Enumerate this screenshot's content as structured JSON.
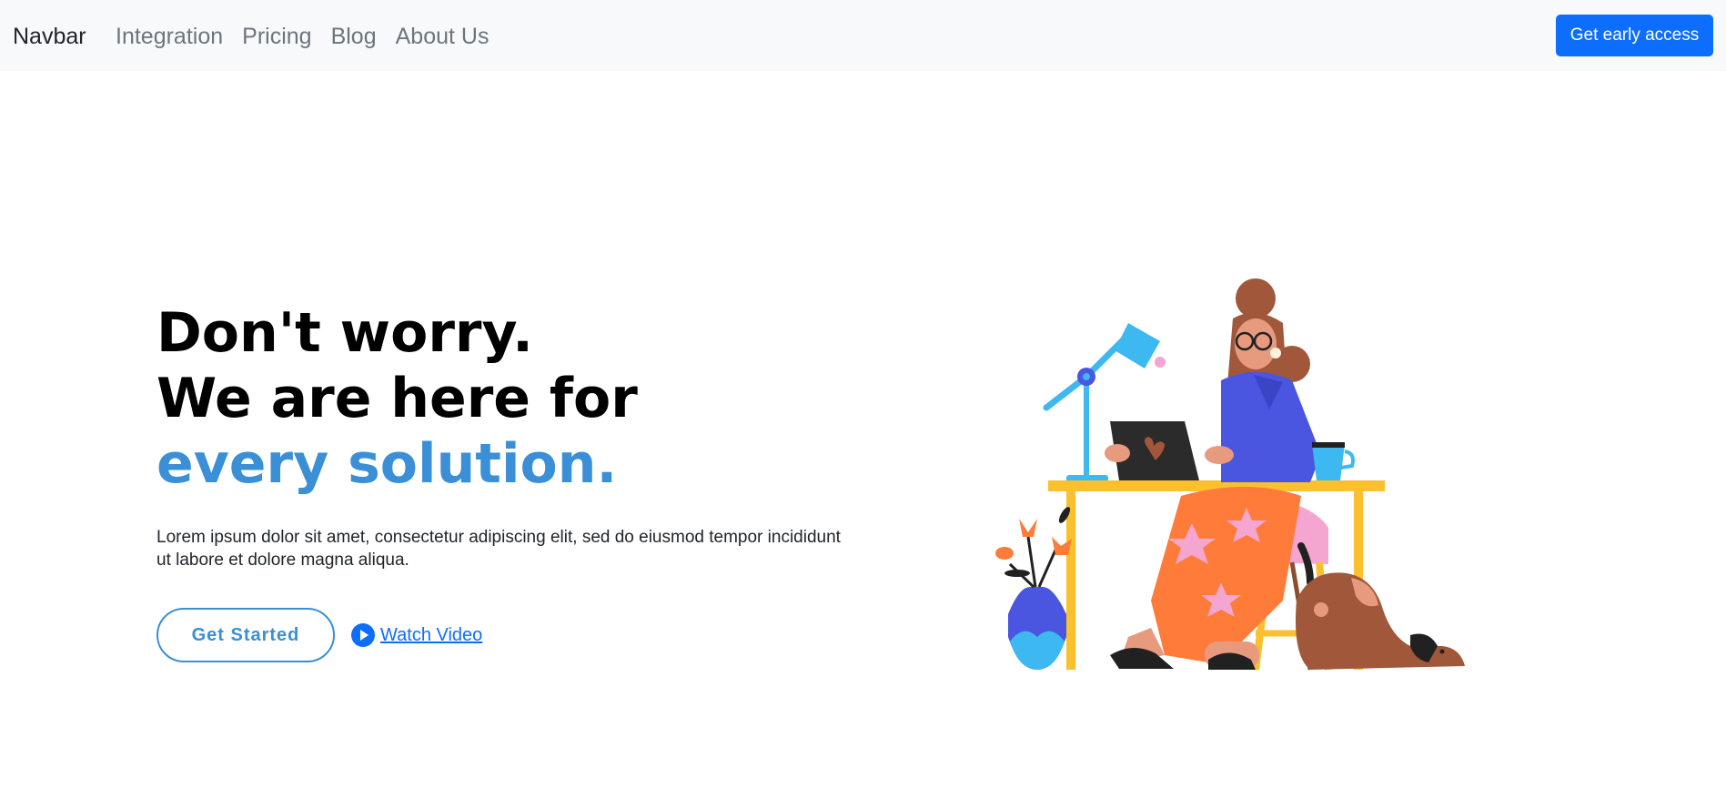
{
  "navbar": {
    "brand": "Navbar",
    "links": [
      "Integration",
      "Pricing",
      "Blog",
      "About Us"
    ],
    "cta_label": "Get early access"
  },
  "hero": {
    "headline_line1": "Don't worry.",
    "headline_line2": "We are here for",
    "headline_accent": "every solution.",
    "lead": "Lorem ipsum dolor sit amet, consectetur adipiscing elit, sed do eiusmod tempor incididunt ut labore et dolore magna aliqua.",
    "primary_label": "Get Started",
    "video_label": " Watch Video"
  },
  "colors": {
    "accent": "#3a8fd6",
    "primary": "#0d6efd",
    "navbar_bg": "#f8f9fa"
  },
  "icons": {
    "play": "play-circle-icon"
  }
}
